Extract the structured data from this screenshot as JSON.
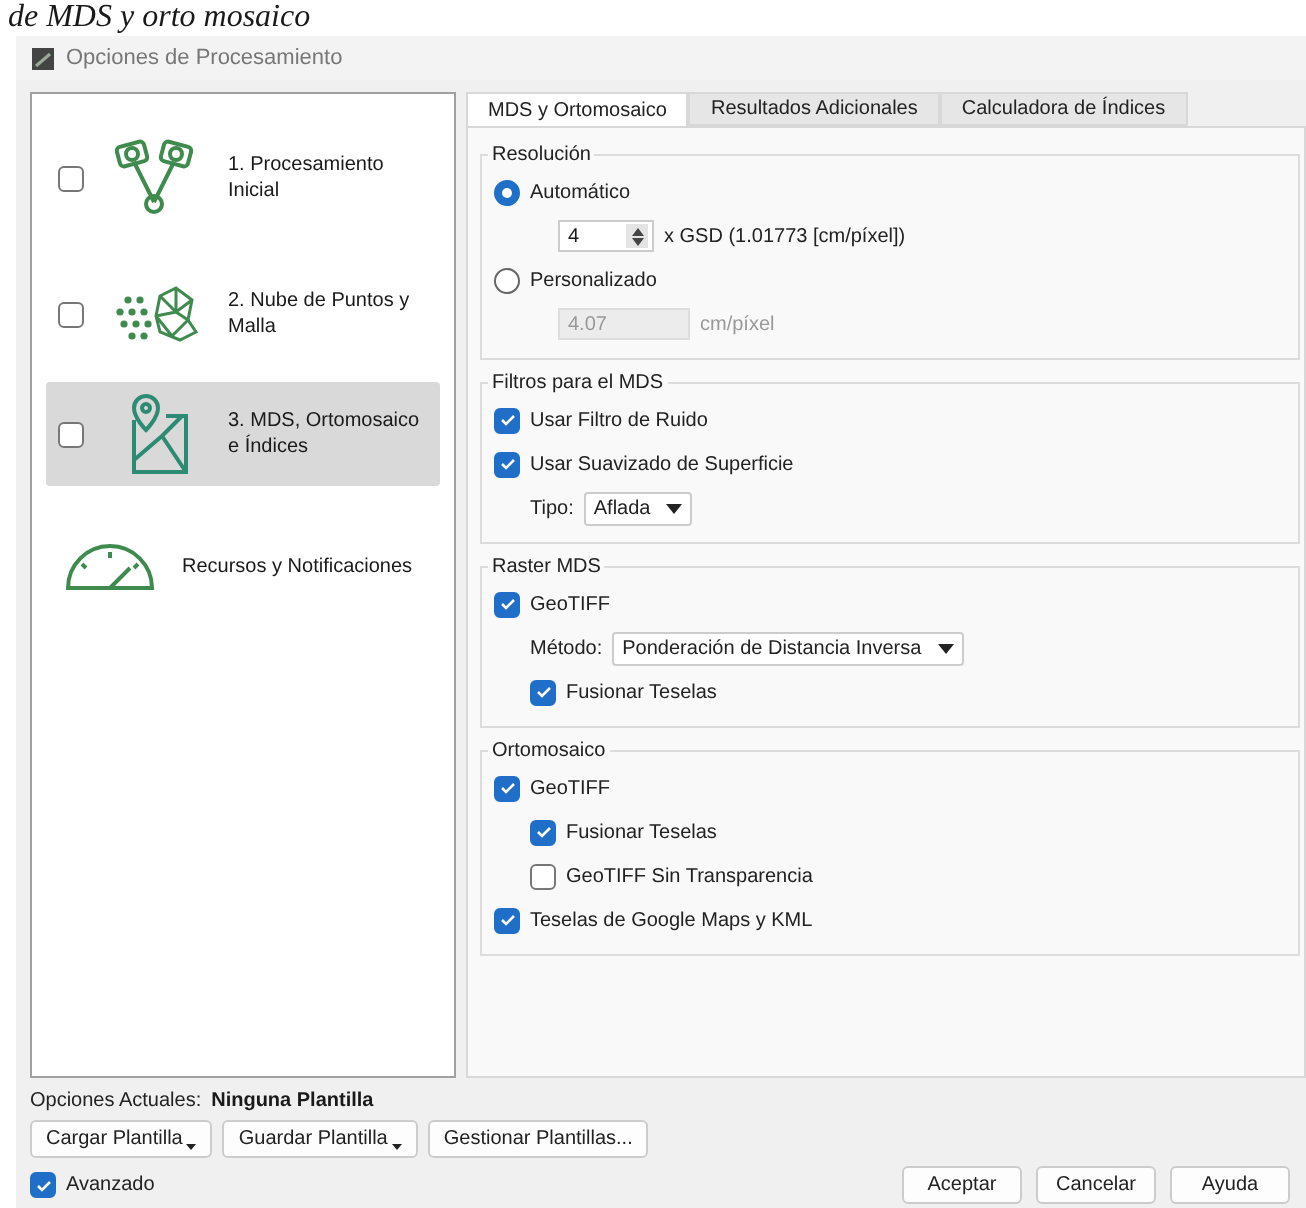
{
  "caption": "de MDS y orto mosaico",
  "window": {
    "title": "Opciones de Procesamiento"
  },
  "steps": [
    {
      "label": "1. Procesamiento Inicial",
      "kind": "cameras",
      "checked": false,
      "selected": false
    },
    {
      "label": "2. Nube de Puntos y Malla",
      "kind": "mesh",
      "checked": false,
      "selected": false
    },
    {
      "label": "3. MDS, Ortomosaico e Índices",
      "kind": "map",
      "checked": false,
      "selected": true
    },
    {
      "label": "Recursos y Notificaciones",
      "kind": "gauge",
      "selected": false
    }
  ],
  "tabs": [
    {
      "label": "MDS y Ortomosaico",
      "selected": true
    },
    {
      "label": "Resultados Adicionales",
      "selected": false
    },
    {
      "label": "Calculadora de Índices",
      "selected": false
    }
  ],
  "groups": [
    {
      "title": "Resolución",
      "rows": [
        {
          "kind": "radio",
          "label": "Automático",
          "selected": true,
          "children": [
            {
              "kind": "spin",
              "value": "4",
              "suffix": "x GSD (1.01773 [cm/píxel])"
            }
          ]
        },
        {
          "kind": "radio",
          "label": "Personalizado",
          "selected": false,
          "children": [
            {
              "kind": "field",
              "value": "4.07",
              "unit": "cm/píxel",
              "disabled": true
            }
          ]
        }
      ]
    },
    {
      "title": "Filtros para el MDS",
      "rows": [
        {
          "kind": "checkbox",
          "label": "Usar Filtro de Ruido",
          "checked": true
        },
        {
          "kind": "checkbox",
          "label": "Usar Suavizado de Superficie",
          "checked": true,
          "children": [
            {
              "kind": "select",
              "label": "Tipo:",
              "value": "Aflada"
            }
          ]
        }
      ]
    },
    {
      "title": "Raster MDS",
      "rows": [
        {
          "kind": "checkbox",
          "label": "GeoTIFF",
          "checked": true,
          "children": [
            {
              "kind": "select",
              "label": "Método:",
              "value": "Ponderación de Distancia Inversa"
            },
            {
              "kind": "checkbox",
              "label": "Fusionar Teselas",
              "checked": true
            }
          ]
        }
      ]
    },
    {
      "title": "Ortomosaico",
      "rows": [
        {
          "kind": "checkbox",
          "label": "GeoTIFF",
          "checked": true,
          "children": [
            {
              "kind": "checkbox",
              "label": "Fusionar Teselas",
              "checked": true
            },
            {
              "kind": "checkbox",
              "label": "GeoTIFF Sin Transparencia",
              "checked": false
            }
          ]
        },
        {
          "kind": "checkbox",
          "label": "Teselas de Google Maps y KML",
          "checked": true
        }
      ]
    }
  ],
  "current_options": {
    "label": "Opciones Actuales:",
    "value": "Ninguna Plantilla"
  },
  "template_buttons": [
    {
      "label": "Cargar Plantilla",
      "menu": true
    },
    {
      "label": "Guardar Plantilla",
      "menu": true
    },
    {
      "label": "Gestionar Plantillas...",
      "menu": false
    }
  ],
  "advanced": {
    "label": "Avanzado",
    "checked": true
  },
  "dialog_buttons": [
    "Aceptar",
    "Cancelar",
    "Ayuda"
  ]
}
